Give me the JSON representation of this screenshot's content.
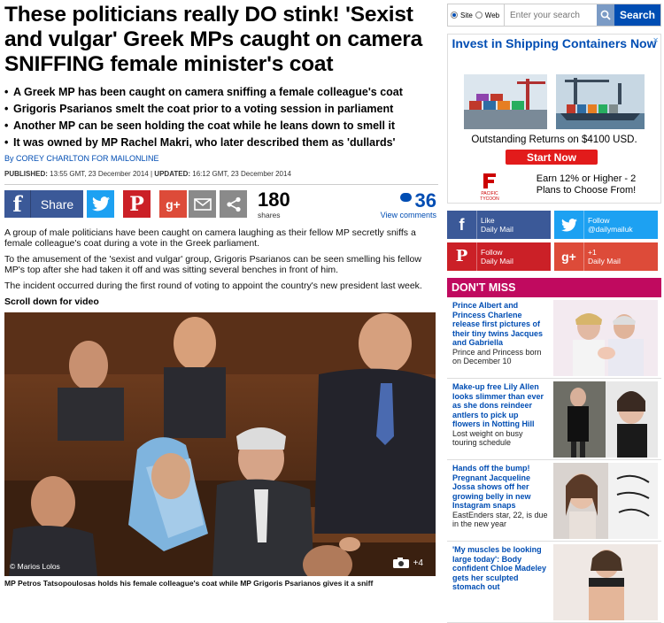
{
  "article": {
    "headline": "These politicians really DO stink! 'Sexist and vulgar' Greek MPs caught on camera SNIFFING female minister's coat",
    "bullets": [
      "A Greek MP has been caught on camera sniffing a female colleague's coat",
      "Grigoris Psarianos smelt the coat prior to a voting session in parliament",
      "Another MP can be seen holding the coat while he leans down to smell it",
      "It was owned by MP Rachel Makri, who later described them as 'dullards'"
    ],
    "byline": "By COREY CHARLTON FOR MAILONLINE",
    "published_label": "PUBLISHED:",
    "published": "13:55 GMT, 23 December 2014",
    "separator": "|",
    "updated_label": "UPDATED:",
    "updated": "16:12 GMT, 23 December 2014",
    "paragraphs": [
      "A group of male politicians have been caught on camera laughing as their fellow MP secretly sniffs a female colleague's coat during a vote in the Greek parliament.",
      "To the amusement of the 'sexist and vulgar' group, Grigoris Psarianos can be seen smelling his fellow MP's top after she had taken it off and was sitting several benches in front of him.",
      "The incident occurred during the first round of voting to appoint the country's new president last week."
    ],
    "scroll_label": "Scroll down for video",
    "photo_credit": "© Marios Lolos",
    "photo_count": "+4",
    "caption": "MP Petros Tatsopoulosas holds his female colleague's coat while MP Grigoris Psarianos gives it a sniff"
  },
  "share": {
    "facebook_label": "Share",
    "shares_count": "180",
    "shares_label": "shares",
    "comments_count": "36",
    "comments_label": "View comments"
  },
  "search": {
    "site_label": "Site",
    "web_label": "Web",
    "placeholder": "Enter your search",
    "button": "Search"
  },
  "ad": {
    "title": "Invest in Shipping Containers Now",
    "outstanding": "Outstanding Returns on $4100 USD.",
    "cta": "Start Now",
    "earn": "Earn 12% or Higher - 2 Plans to Choose From!",
    "logo_text": "PACIFIC TYCOON"
  },
  "social": [
    {
      "title": "Like",
      "sub": "Daily Mail",
      "color": "#3b5998",
      "icon": "facebook-icon",
      "glyph": "f"
    },
    {
      "title": "Follow",
      "sub": "@dailymailuk",
      "color": "#1da1f2",
      "icon": "twitter-icon",
      "glyph": "t"
    },
    {
      "title": "Follow",
      "sub": "Daily Mail",
      "color": "#cb2027",
      "icon": "pinterest-icon",
      "glyph": "P"
    },
    {
      "title": "+1",
      "sub": "Daily Mail",
      "color": "#dd4b39",
      "icon": "google-plus-icon",
      "glyph": "g+"
    }
  ],
  "dont_miss": {
    "header": "DON'T MISS",
    "items": [
      {
        "title": "Prince Albert and Princess Charlene release first pictures of their tiny twins Jacques and Gabriella",
        "sub": "Prince and Princess born on December 10"
      },
      {
        "title": "Make-up free Lily Allen looks slimmer than ever as she dons reindeer antlers to pick up flowers in Notting Hill",
        "sub": "Lost weight on busy touring schedule"
      },
      {
        "title": "Hands off the bump! Pregnant Jacqueline Jossa shows off her growing belly in new Instagram snaps",
        "sub": "EastEnders star, 22, is due in the new year"
      },
      {
        "title": "'My muscles be looking large today': Body confident Chloe Madeley gets her sculpted stomach out",
        "sub": ""
      }
    ]
  },
  "colors": {
    "link": "#004db3",
    "accent": "#c00a5f"
  }
}
